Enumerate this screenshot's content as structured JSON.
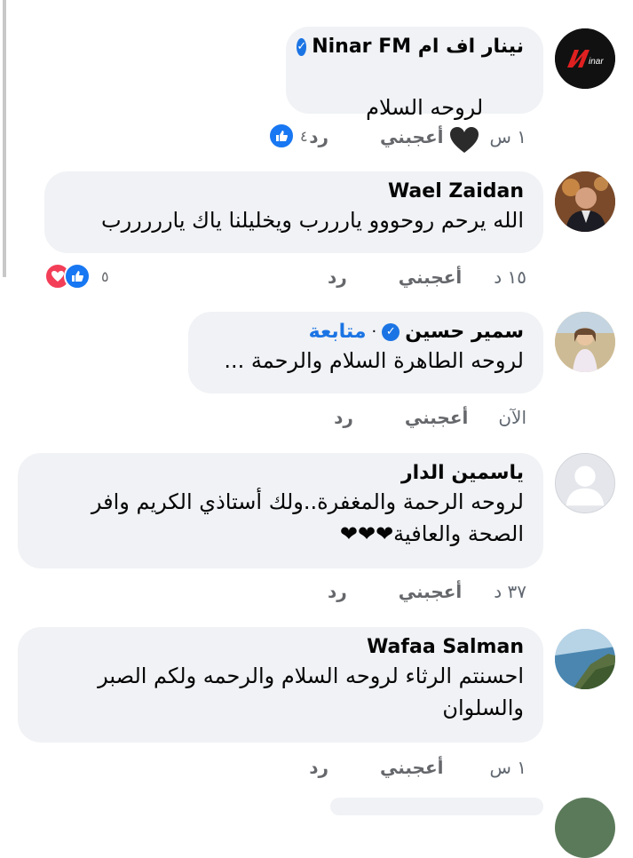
{
  "comments": [
    {
      "name": "نينار اف ام Ninar FM",
      "verified": true,
      "text": "لروحه السلام",
      "time": "١ س",
      "like": "أعجبني",
      "reply": "رد",
      "reaction_count": "٤",
      "reactions": [
        "like"
      ]
    },
    {
      "name": "Wael Zaidan",
      "verified": false,
      "text": "الله يرحم روحووو يارررب ويخليلنا ياك يارررررب",
      "time": "١٥ د",
      "like": "أعجبني",
      "reply": "رد",
      "reaction_count": "٥",
      "reactions": [
        "like",
        "love"
      ]
    },
    {
      "name": "سمير حسين",
      "verified": true,
      "follow": "متابعة",
      "text": "لروحه الطاهرة السلام والرحمة ...",
      "time": "الآن",
      "like": "أعجبني",
      "reply": "رد"
    },
    {
      "name": "ياسمين الدار",
      "verified": false,
      "text": "لروحه الرحمة والمغفرة..ولك أستاذي الكريم وافر\nالصحة والعافية❤❤❤",
      "time": "٣٧ د",
      "like": "أعجبني",
      "reply": "رد"
    },
    {
      "name": "Wafaa Salman",
      "verified": false,
      "text": "احسنتم الرثاء لروحه السلام والرحمه ولكم الصبر\nوالسلوان",
      "time": "١ س",
      "like": "أعجبني",
      "reply": "رد"
    }
  ],
  "colors": {
    "bubble": "#f0f2f5",
    "link": "#1b74e4",
    "like": "#1877f2",
    "love": "#f33e58"
  }
}
